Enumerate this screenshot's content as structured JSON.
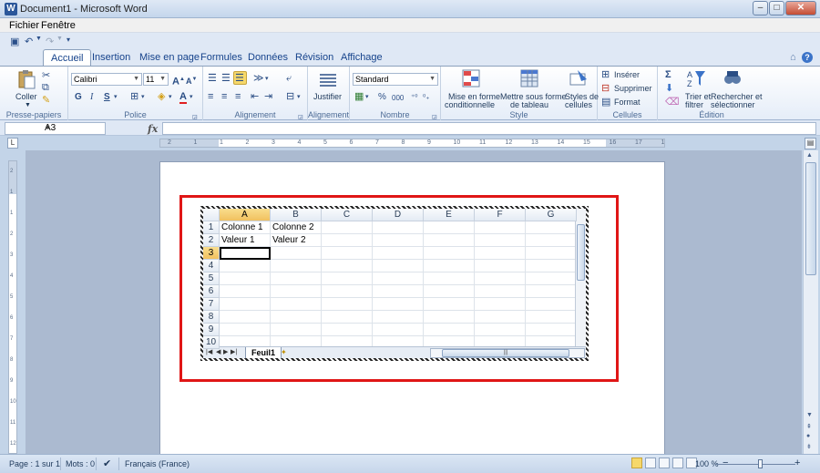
{
  "window": {
    "title": "Document1 - Microsoft Word",
    "app_icon": "W"
  },
  "menu": {
    "items": [
      "Fichier",
      "Fenêtre"
    ]
  },
  "ribbon_tabs": [
    "Accueil",
    "Insertion",
    "Mise en page",
    "Formules",
    "Données",
    "Révision",
    "Affichage"
  ],
  "ribbon": {
    "paste_label": "Coller",
    "font_name": "Calibri",
    "font_size": "11",
    "justify_label": "Justifier",
    "number_format": "Standard",
    "percent": "%",
    "thousands": "000",
    "cond_format": [
      "Mise en forme",
      "conditionnelle"
    ],
    "format_table": [
      "Mettre sous forme",
      "de tableau"
    ],
    "cell_styles": [
      "Styles de",
      "cellules"
    ],
    "insert_label": "Insérer",
    "delete_label": "Supprimer",
    "format_label": "Format",
    "sort_filter": [
      "Trier et",
      "filtrer"
    ],
    "find_select": [
      "Rechercher et",
      "sélectionner"
    ],
    "groups": [
      "Presse-papiers",
      "Police",
      "Alignement",
      "Alignement",
      "Nombre",
      "Style",
      "Cellules",
      "Édition"
    ]
  },
  "formula_bar": {
    "name_box": "A3",
    "fx": "fx",
    "value": ""
  },
  "ruler": {
    "marks": [
      "2",
      "1",
      "1",
      "2",
      "3",
      "4",
      "5",
      "6",
      "7",
      "8",
      "9",
      "10",
      "11",
      "12",
      "13",
      "14",
      "15",
      "16",
      "17",
      "18"
    ]
  },
  "vruler": {
    "marks": [
      "2",
      "1",
      "1",
      "2",
      "3",
      "4",
      "5",
      "6",
      "7",
      "8",
      "9",
      "10",
      "11",
      "12"
    ]
  },
  "spreadsheet": {
    "columns": [
      "A",
      "B",
      "C",
      "D",
      "E",
      "F",
      "G"
    ],
    "rows": [
      "1",
      "2",
      "3",
      "4",
      "5",
      "6",
      "7",
      "8",
      "9",
      "10"
    ],
    "cells": {
      "A1": "Colonne 1",
      "B1": "Colonne 2",
      "A2": "Valeur 1",
      "B2": "Valeur 2"
    },
    "active_cell": "A3",
    "sheet_tab": "Feuil1"
  },
  "status": {
    "page": "Page : 1 sur 1",
    "words": "Mots : 0",
    "language": "Français (France)",
    "zoom": "100 %",
    "zoom_minus": "−",
    "zoom_plus": "+"
  }
}
